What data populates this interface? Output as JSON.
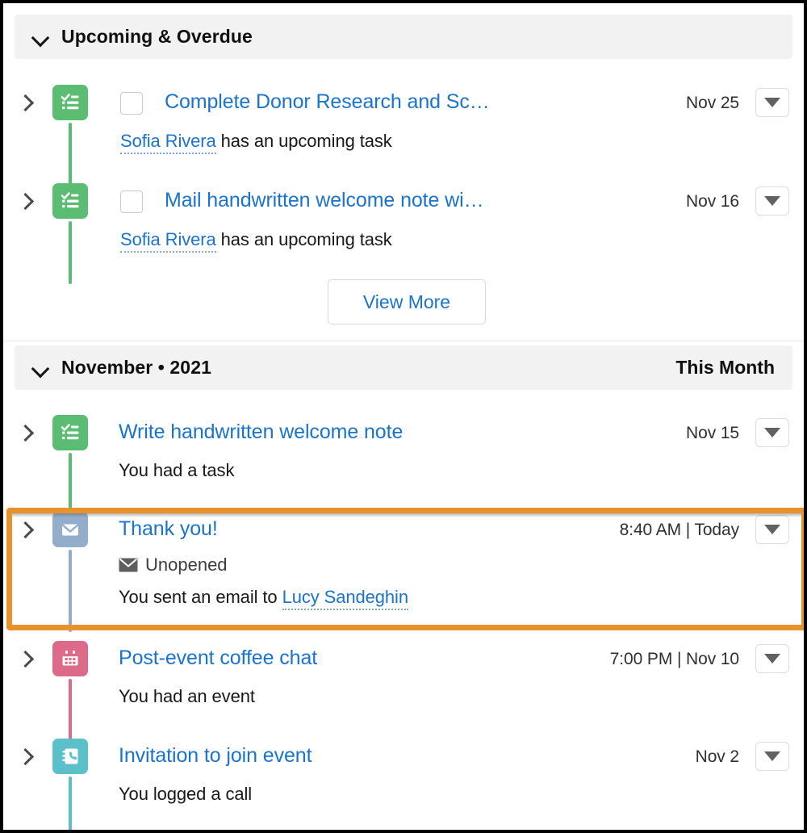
{
  "sections": [
    {
      "id": "upcoming-overdue",
      "title": "Upcoming & Overdue",
      "right_label": ""
    },
    {
      "id": "november-2021",
      "title": "November • 2021",
      "right_label": "This Month"
    }
  ],
  "view_more_label": "View More",
  "colors": {
    "task_green": "#5bbd72",
    "email_blue_gray": "#93aecd",
    "event_pink": "#de6a89",
    "call_teal": "#5cc0cb",
    "link_blue": "#1a73cc",
    "highlight_orange": "#e8912d",
    "header_gray": "#f2f2f2"
  },
  "upcoming_items": [
    {
      "icon": "task-checklist-icon",
      "icon_color": "#5bbd72",
      "has_checkbox": true,
      "checkbox_checked": false,
      "title": "Complete Donor Research and Sc…",
      "subject_link": "Sofia Rivera",
      "subject_rest": " has an upcoming task",
      "meta": "Nov 25",
      "caret": "chevron-down-icon"
    },
    {
      "icon": "task-checklist-icon",
      "icon_color": "#5bbd72",
      "has_checkbox": true,
      "checkbox_checked": false,
      "title": "Mail handwritten welcome note wi…",
      "subject_link": "Sofia Rivera",
      "subject_rest": " has an upcoming task",
      "meta": "Nov 16",
      "caret": "chevron-down-icon"
    }
  ],
  "month_items": [
    {
      "icon": "task-checklist-icon",
      "icon_color": "#5bbd72",
      "has_checkbox": false,
      "title": "Write handwritten welcome note",
      "subject_rest": "You had a task",
      "meta": "Nov 15",
      "status": null,
      "caret": "chevron-down-icon"
    },
    {
      "icon": "email-envelope-icon",
      "icon_color": "#93aecd",
      "has_checkbox": false,
      "title": "Thank you!",
      "status": "Unopened",
      "status_icon": "envelope-icon",
      "subject_rest": "You sent an email to ",
      "subject_link": "Lucy Sandeghin",
      "meta": "8:40 AM | Today",
      "caret": "chevron-down-icon",
      "highlighted": true
    },
    {
      "icon": "calendar-event-icon",
      "icon_color": "#de6a89",
      "has_checkbox": false,
      "title": "Post-event coffee chat",
      "subject_rest": "You had an event",
      "meta": "7:00 PM | Nov 10",
      "status": null,
      "caret": "chevron-down-icon"
    },
    {
      "icon": "call-log-icon",
      "icon_color": "#5cc0cb",
      "has_checkbox": false,
      "title": "Invitation to join event",
      "subject_rest": "You logged a call",
      "meta": "Nov 2",
      "status": null,
      "caret": "chevron-down-icon"
    }
  ]
}
